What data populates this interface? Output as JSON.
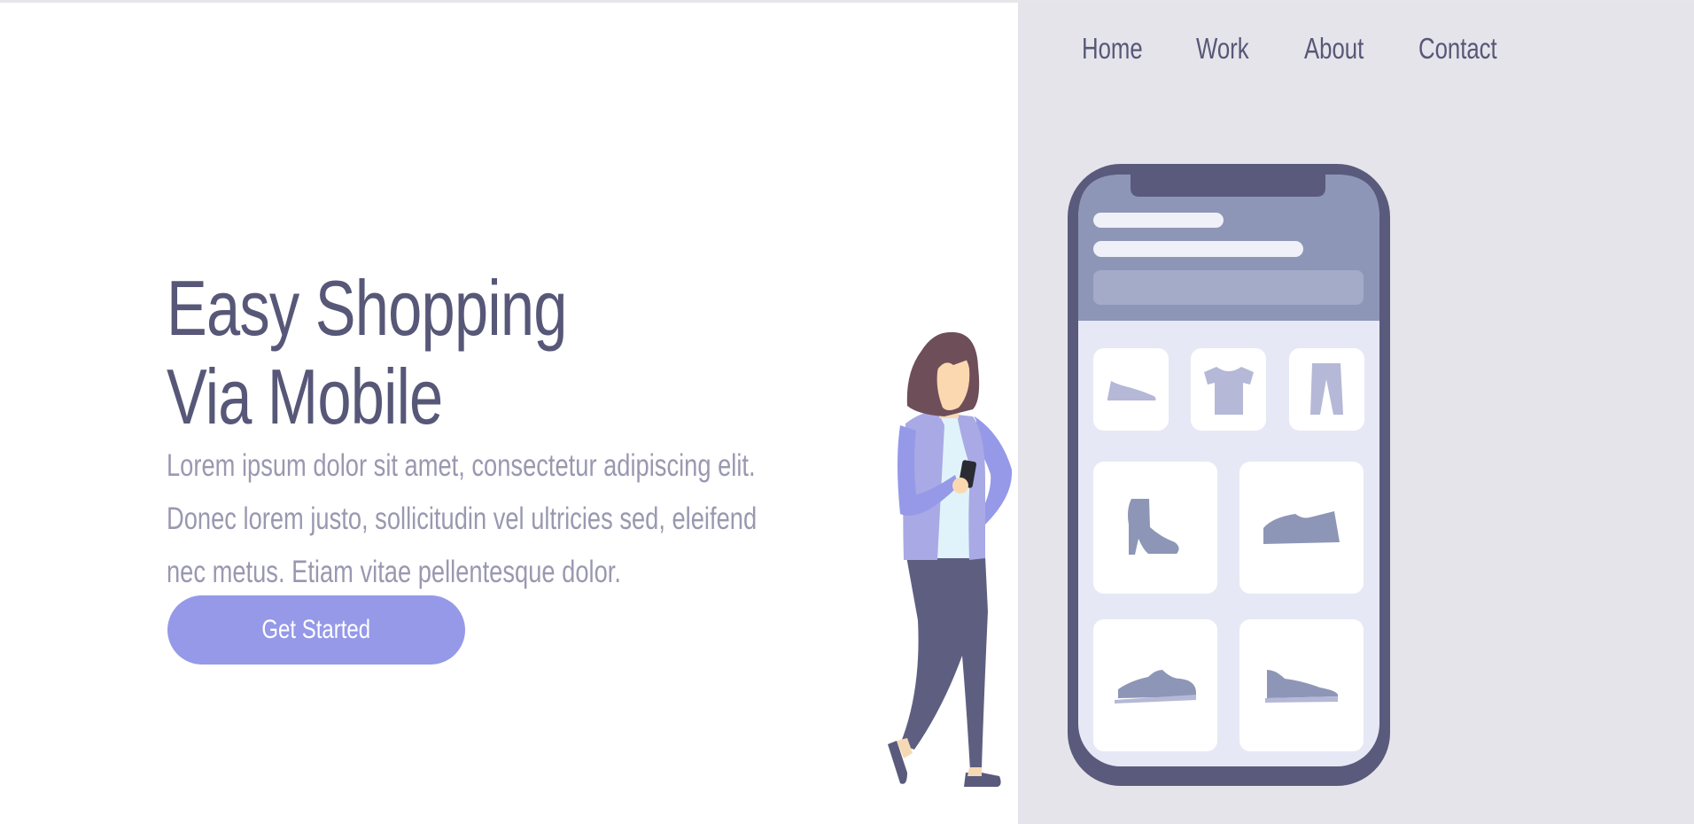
{
  "nav": {
    "items": [
      {
        "label": "Home"
      },
      {
        "label": "Work"
      },
      {
        "label": "About"
      },
      {
        "label": "Contact"
      }
    ]
  },
  "hero": {
    "title_line1": "Easy Shopping",
    "title_line2": "Via Mobile",
    "description": "Lorem ipsum dolor sit amet, consectetur adipiscing elit. Donec lorem justo, sollicitudin vel ultricies sed, eleifend nec metus. Etiam vitae pellentesque dolor.",
    "cta_label": "Get Started"
  },
  "colors": {
    "text_dark": "#575778",
    "text_muted": "#9a98b0",
    "accent": "#9599e8",
    "panel_bg": "#e5e4ea",
    "phone_frame": "#5a5a7d"
  },
  "illustration": {
    "phone_product_icons": [
      "flat-shoe-icon",
      "tshirt-icon",
      "pants-icon",
      "ankle-boot-icon",
      "sneaker-icon",
      "sneaker-icon",
      "sneaker-icon"
    ],
    "person": "woman-holding-phone"
  }
}
